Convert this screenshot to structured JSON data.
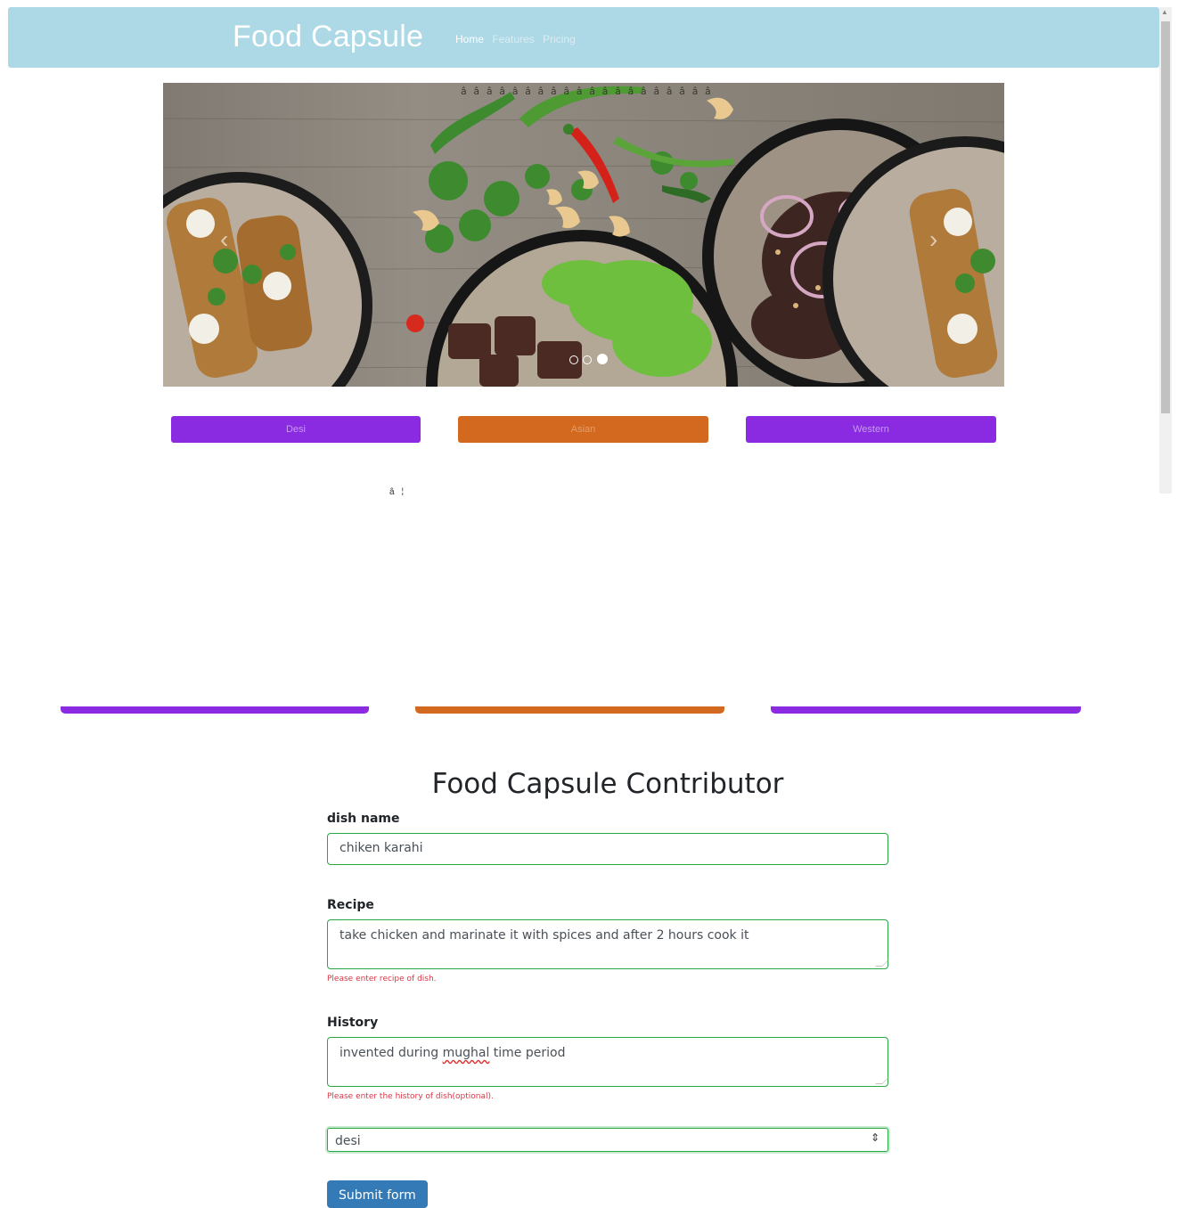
{
  "navbar": {
    "brand": "Food Capsule",
    "links": [
      {
        "label": "Home",
        "active": true
      },
      {
        "label": "Features",
        "active": false
      },
      {
        "label": "Pricing",
        "active": false
      }
    ],
    "background_color": "#add8e6"
  },
  "carousel": {
    "caption_strip": "â­â­â­â­â­â­â­â­â­â­â­â­â­â­â­â­â­â­â­â­",
    "prev_glyph": "‹",
    "next_glyph": "›",
    "slide_count": 3,
    "active_slide": 3
  },
  "categories": {
    "desi": "Desi",
    "asian": "Asian",
    "western": "Western",
    "purple": "#8a2be2",
    "orange": "#d2691e"
  },
  "stray_text": "â¦",
  "form": {
    "title": "Food Capsule Contributor",
    "dish_name_label": "dish name",
    "dish_name_value": "chiken karahi",
    "recipe_label": "Recipe",
    "recipe_value": "take chicken and marinate it with spices and after 2 hours cook it",
    "recipe_feedback": "Please enter recipe of dish.",
    "history_label": "History",
    "history_before": "invented during ",
    "history_misspelled": "mughal",
    "history_after": " time period",
    "history_feedback": "Please enter the history of dish(optional).",
    "category_selected": "desi",
    "submit_label": "Submit form",
    "valid_color": "#28a745",
    "invalid_color": "#dc3545",
    "submit_color": "#337ab7"
  }
}
